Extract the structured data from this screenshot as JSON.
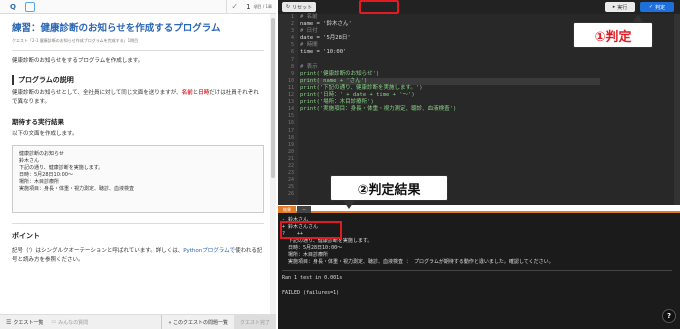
{
  "topbar": {
    "logo_text": "Q",
    "progress_num": "1",
    "progress_text": "項目 / 1章"
  },
  "lesson": {
    "title": "練習：健康診断のお知らせを作成するプログラム",
    "subtitle": "クエスト「2-1 健康診断のお知らせ作成プログラムを完成する」1問目",
    "intro": "健康診断のお知らせをするプログラムを作成します。",
    "section_description": "プログラムの説明",
    "description_a": "健康診断のお知らせとして、全社員に対して同じ文面を送りますが、",
    "description_red1": "名前",
    "description_b": "と",
    "description_red2": "日時",
    "description_c": "だけは社員それぞれで異なります。",
    "section_expected": "期待する実行結果",
    "expected_intro": "以下の文面を作成します。",
    "expected_output": [
      "健康診断のお知らせ",
      "鈴木さん",
      "下記の通り、健康診断を実施します。",
      "日時：5月28日10:00〜",
      "場所：木目診療所",
      "実施項目：身長・体重・視力測定、聴診、血液検査"
    ],
    "section_point": "ポイント",
    "point_text_a": "記号（'）はシングルクオーテーションと呼ばれています。詳しくは、",
    "point_link": "Pythonプログラムで",
    "point_text_b": "使われる記号と読み方を参照ください。"
  },
  "bottombar": {
    "quest_list": "クエスト一覧",
    "board": "みんなの質問",
    "quests_nav": "« このクエストの問題一覧",
    "complete": "クエスト完了"
  },
  "editor": {
    "reset_label": "リセット",
    "run_label": "実行",
    "judge_label": "判定",
    "line_numbers": [
      "1",
      "2",
      "3",
      "4",
      "5",
      "6",
      "7",
      "8",
      "9",
      "10",
      "11",
      "12",
      "13",
      "14",
      "15",
      "16",
      "17",
      "18",
      "19",
      "20",
      "21",
      "22",
      "23",
      "24",
      "25",
      "26"
    ],
    "lines": [
      "# 名前",
      "name = '鈴木さん'",
      "# 日付",
      "date = '5月28日'",
      "# 時間",
      "time = '10:00'",
      "",
      "# 表示",
      "print('健康診断のお知らせ')",
      "print( name + 'さん')",
      "print('下記の通り、健康診断を実施します。')",
      "print('日時：' + date + time + '〜')",
      "print('場所：木目診療所')",
      "print('実施項目：身長・体重・視力測定、聴診、血液検査')",
      "",
      "",
      "",
      "",
      "",
      "",
      "",
      "",
      "",
      "",
      "",
      ""
    ]
  },
  "console": {
    "tab_result": "結果",
    "tab_other": "ー",
    "lines": [
      "- 鈴木さん",
      "+ 鈴木さんさん",
      "?    ++",
      "  下記の通り、健康診断を実施します。",
      "  日時：5月28日10:00〜",
      "  場所：木目診療所",
      "  実施項目：身長・体重・視力測定、聴診、血液検査 ： プログラムが期待する動作と違いました。確認してください。"
    ],
    "ran_line": "Ran 1 test in 0.001s",
    "failed_line": "FAILED (failures=1)"
  },
  "annotations": {
    "judge": "①判定",
    "result": "②判定結果"
  },
  "help_label": "?",
  "colors": {
    "accent_blue": "#1e6fd9",
    "annotation_red": "#e11b22",
    "console_accent": "#e07b2a"
  }
}
